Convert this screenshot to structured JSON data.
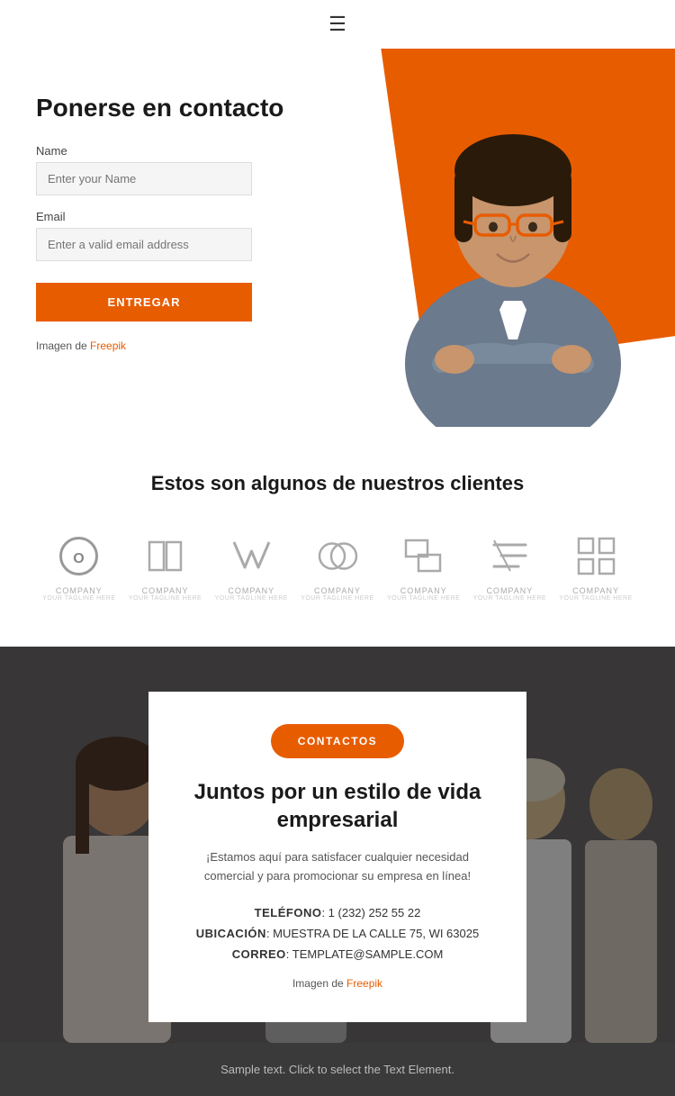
{
  "nav": {
    "hamburger_label": "☰"
  },
  "hero": {
    "title": "Ponerse en contacto",
    "name_label": "Name",
    "name_placeholder": "Enter your Name",
    "email_label": "Email",
    "email_placeholder": "Enter a valid email address",
    "submit_label": "ENTREGAR",
    "credit_text": "Imagen de ",
    "credit_link": "Freepik",
    "credit_href": "#"
  },
  "clients": {
    "title": "Estos son algunos de nuestros clientes",
    "logos": [
      {
        "id": 1,
        "name": "COMPANY",
        "sub": "YOUR TAGLINE HERE",
        "type": "circle"
      },
      {
        "id": 2,
        "name": "COMPANY",
        "sub": "YOUR TAGLINE HERE",
        "type": "square"
      },
      {
        "id": 3,
        "name": "COMPANY",
        "sub": "YOUR TAGLINE HERE",
        "type": "check"
      },
      {
        "id": 4,
        "name": "COMPANY",
        "sub": "YOUR TAGLINE HERE",
        "type": "rings"
      },
      {
        "id": 5,
        "name": "COMPANY",
        "sub": "YOUR TAGLINE HERE",
        "type": "stack"
      },
      {
        "id": 6,
        "name": "COMPANY",
        "sub": "YOUR TAGLINE HERE",
        "type": "lines"
      },
      {
        "id": 7,
        "name": "COMPANY",
        "sub": "YOUR TAGLINE HERE",
        "type": "cross"
      }
    ]
  },
  "contact_section": {
    "button_label": "CONTACTOS",
    "title_line1": "Juntos por un estilo de vida",
    "title_line2": "empresarial",
    "description": "¡Estamos aquí para satisfacer cualquier necesidad comercial y para promocionar su empresa en línea!",
    "phone_label": "TELÉFONO",
    "phone_value": ": 1 (232) 252 55 22",
    "location_label": "UBICACIÓN",
    "location_value": ": MUESTRA DE LA CALLE 75, WI 63025",
    "email_label": "CORREO",
    "email_value": ": TEMPLATE@SAMPLE.COM",
    "credit_text": "Imagen de ",
    "credit_link": "Freepik",
    "credit_href": "#"
  },
  "footer": {
    "text": "Sample text. Click to select the Text Element."
  }
}
